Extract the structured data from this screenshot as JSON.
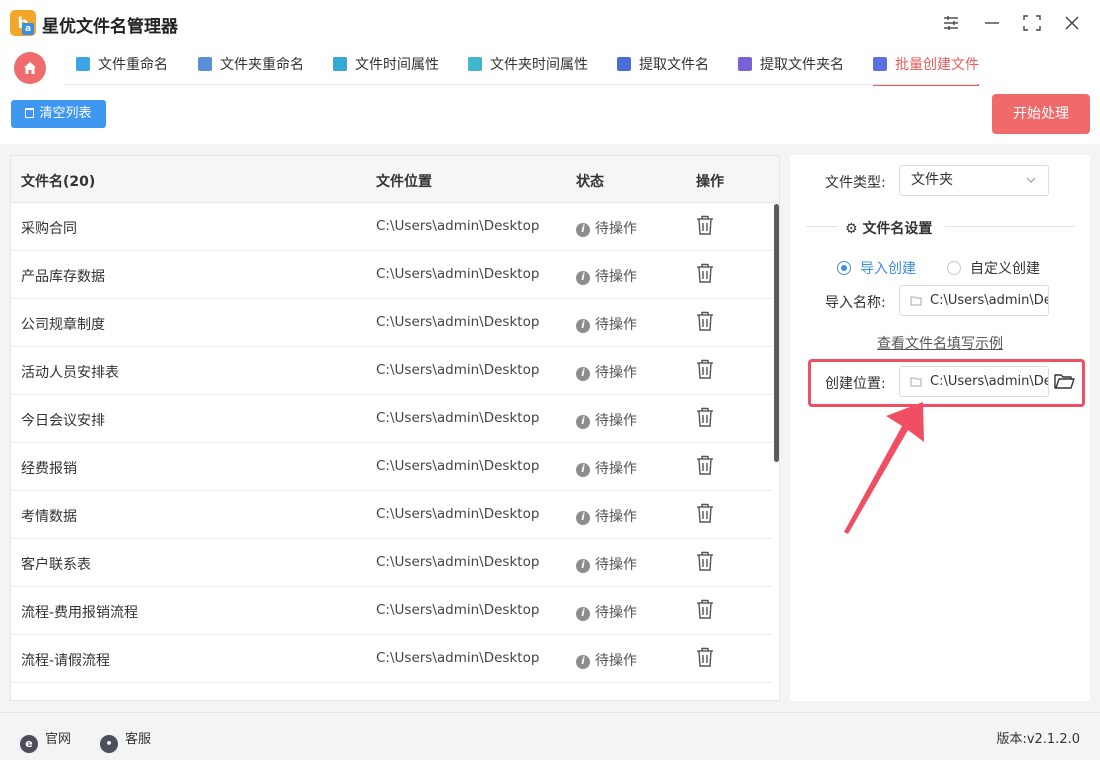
{
  "app": {
    "title": "星优文件名管理器",
    "logo_letter": "b",
    "logo_badge": "a"
  },
  "tabs": [
    {
      "label": "文件重命名",
      "icon": "file-rename-icon",
      "color": "#3aa6e8"
    },
    {
      "label": "文件夹重命名",
      "icon": "folder-rename-icon",
      "color": "#5b8fd8"
    },
    {
      "label": "文件时间属性",
      "icon": "file-time-icon",
      "color": "#35a9d6"
    },
    {
      "label": "文件夹时间属性",
      "icon": "folder-time-icon",
      "color": "#3db7c9"
    },
    {
      "label": "提取文件名",
      "icon": "extract-filename-icon",
      "color": "#4a6fd6"
    },
    {
      "label": "提取文件夹名",
      "icon": "extract-foldername-icon",
      "color": "#7a62d4"
    },
    {
      "label": "批量创建文件",
      "icon": "batch-create-icon",
      "color": "#5b6fe0",
      "active": true
    }
  ],
  "toolbar": {
    "clear_label": "清空列表",
    "start_label": "开始处理"
  },
  "table": {
    "headers": {
      "name": "文件名(20)",
      "location": "文件位置",
      "status": "状态",
      "action": "操作"
    },
    "rows": [
      {
        "name": "采购合同",
        "location": "C:\\Users\\admin\\Desktop",
        "status": "待操作"
      },
      {
        "name": "产品库存数据",
        "location": "C:\\Users\\admin\\Desktop",
        "status": "待操作"
      },
      {
        "name": "公司规章制度",
        "location": "C:\\Users\\admin\\Desktop",
        "status": "待操作"
      },
      {
        "name": "活动人员安排表",
        "location": "C:\\Users\\admin\\Desktop",
        "status": "待操作"
      },
      {
        "name": "今日会议安排",
        "location": "C:\\Users\\admin\\Desktop",
        "status": "待操作"
      },
      {
        "name": "经费报销",
        "location": "C:\\Users\\admin\\Desktop",
        "status": "待操作"
      },
      {
        "name": "考情数据",
        "location": "C:\\Users\\admin\\Desktop",
        "status": "待操作"
      },
      {
        "name": "客户联系表",
        "location": "C:\\Users\\admin\\Desktop",
        "status": "待操作"
      },
      {
        "name": "流程-费用报销流程",
        "location": "C:\\Users\\admin\\Desktop",
        "status": "待操作"
      },
      {
        "name": "流程-请假流程",
        "location": "C:\\Users\\admin\\Desktop",
        "status": "待操作"
      }
    ]
  },
  "panel": {
    "file_type_label": "文件类型:",
    "file_type_value": "文件夹",
    "section_title": "文件名设置",
    "radio_import": "导入创建",
    "radio_custom": "自定义创建",
    "import_name_label": "导入名称:",
    "import_name_value": "C:\\Users\\admin\\De",
    "example_link": "查看文件名填写示例",
    "create_location_label": "创建位置:",
    "create_location_value": "C:\\Users\\admin\\Des"
  },
  "footer": {
    "website_label": "官网",
    "service_label": "客服",
    "version": "版本:v2.1.2.0"
  },
  "colors": {
    "accent_red": "#f06a6a",
    "accent_blue": "#3e97f0",
    "highlight": "#f04e63"
  }
}
